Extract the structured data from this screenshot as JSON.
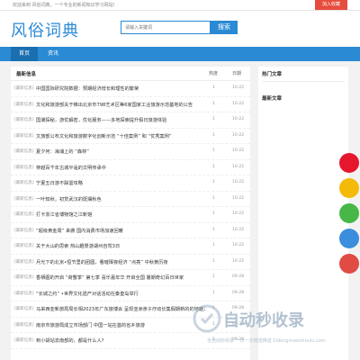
{
  "topbar": {
    "welcome": "欢迎来到 风俗词典，一个专业的新闻知识学习网站!",
    "favorite_label": "加入收藏"
  },
  "header": {
    "logo": "风俗词典",
    "search_placeholder": "请输入关键词",
    "search_button": "搜索"
  },
  "nav": [
    {
      "label": "首页"
    },
    {
      "label": "资讯"
    }
  ],
  "list": {
    "title": "最新信息",
    "col_views": "热度",
    "col_date": "日期",
    "rows": [
      {
        "tag": "[最新信息]",
        "title": "中国国际研究院数据：预期经济增长和理性的繁荣",
        "views": "1",
        "date": "10-22"
      },
      {
        "tag": "[最新信息]",
        "title": "文化和旅游部关于推出北京市798艺术区等6家国家工业旅游示范基地的公告",
        "views": "1",
        "date": "10-22"
      },
      {
        "tag": "[最新信息]",
        "title": "国潮探秘，游优解密，优化服务——多地探索提升假日旅游体验",
        "views": "1",
        "date": "10-22"
      },
      {
        "tag": "[最新信息]",
        "title": "文旅部公布文化和旅游数字化创新示范 “十佳案例” 和 “优秀案例”",
        "views": "1",
        "date": "10-22"
      },
      {
        "tag": "[最新信息]",
        "title": "夏夕何：海浦上的 “森林”",
        "views": "1",
        "date": "10-22"
      },
      {
        "tag": "[最新信息]",
        "title": "穿越百千年古城平遥的文明传承中",
        "views": "1",
        "date": "10-22"
      },
      {
        "tag": "[最新信息]",
        "title": "宁夏五日游不踩雷攻略",
        "views": "1",
        "date": "10-22"
      },
      {
        "tag": "[最新信息]",
        "title": "一叶知秋，初赏武汉的斑斓秋色",
        "views": "1",
        "date": "10-22"
      },
      {
        "tag": "[最新信息]",
        "title": "打卡浙江省博物馆之江新馆",
        "views": "1",
        "date": "10-22"
      },
      {
        "tag": "[最新信息]",
        "title": "“超级黄金周” 来袭 国内消费市场加速回暖",
        "views": "1",
        "date": "10-22"
      },
      {
        "tag": "[最新信息]",
        "title": "关于大山的思索 热山趣景游湖州自驾3日",
        "views": "1",
        "date": "10-22"
      },
      {
        "tag": "[最新信息]",
        "title": "月光下的北京•恒节里的团圆，看璀璨夜经济 “点亮” 中秋黄历夜",
        "views": "1",
        "date": "10-22"
      },
      {
        "tag": "[最新信息]",
        "title": "香栖图的开启 “荷蟹季” 第七季 喜乐嘉年华 开启全国 暑期奇幻百日世家",
        "views": "1",
        "date": "09-28"
      },
      {
        "tag": "[最新信息]",
        "title": "“长城之约” •世界文化遗产对话活动在秦皇岛举行",
        "views": "1",
        "date": "09-28"
      },
      {
        "tag": "[最新信息]",
        "title": "马来西亚新旅局局长相2023年广东旅博会 呈现亚洲亲子疗动长集假期新的的地魅力",
        "views": "1",
        "date": "09-28"
      },
      {
        "tag": "[最新信息]",
        "title": "南京市旅游局成立市场部门 中国一站在首的省乡旅游",
        "views": "1",
        "date": "09-28"
      },
      {
        "tag": "[最新信息]",
        "title": "到小胡站去南部的，都是什么人?",
        "views": "1",
        "date": "09-28"
      }
    ]
  },
  "sidebar": {
    "hot_title": "热门文章",
    "latest_title": "最新文章"
  },
  "float_buttons": [
    {
      "icon": "weibo-icon",
      "color": "#e6162d"
    },
    {
      "icon": "qzone-icon",
      "color": "#f5b90a"
    },
    {
      "icon": "wechat-icon",
      "color": "#47b748"
    },
    {
      "icon": "qq-icon",
      "color": "#3b8edb"
    },
    {
      "icon": "arrow-up-icon",
      "color": "#e04b44"
    }
  ],
  "watermark": {
    "text": "自动秒收录",
    "subtitle": "全自动秒收录 一次一次赠送推送 Zidongmiaoshoulu.com"
  },
  "colors": {
    "accent": "#2a8ad4",
    "nav_active": "#1a6fb0",
    "favorite": "#e74c3c"
  }
}
